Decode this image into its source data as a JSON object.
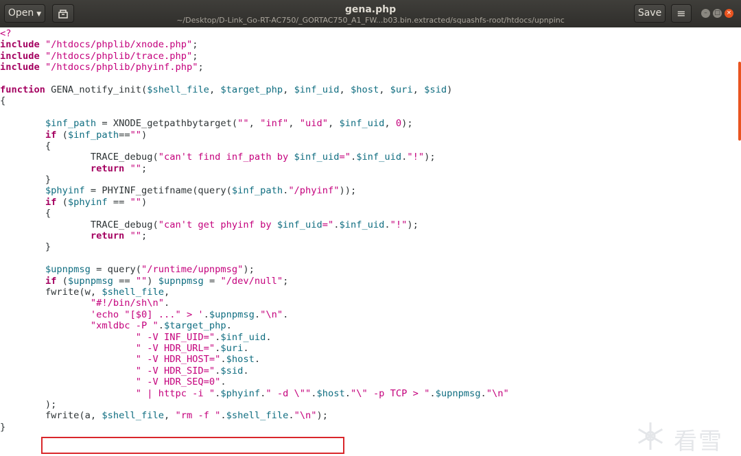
{
  "titlebar": {
    "open_label": "Open",
    "recent_icon": "document-recent-icon",
    "title": "gena.php",
    "path": "~/Desktop/D-Link_Go-RT-AC750/_GORTAC750_A1_FW...b03.bin.extracted/squashfs-root/htdocs/upnpinc",
    "save_label": "Save",
    "menu_icon": "hamburger-menu-icon",
    "window_controls": [
      "minimize-icon",
      "maximize-icon",
      "close-icon"
    ]
  },
  "colors": {
    "titlebar": "#3a3936",
    "keyword": "#a40060",
    "string": "#c4007c",
    "variable": "#0f6d80",
    "accent": "#e95420",
    "highlight_box": "#d9262a"
  },
  "code_lines": [
    [
      {
        "t": "<?",
        "c": "str"
      }
    ],
    [
      {
        "t": "include",
        "c": "kw"
      },
      {
        "t": " "
      },
      {
        "t": "\"/htdocs/phplib/xnode.php\"",
        "c": "str"
      },
      {
        "t": ";"
      }
    ],
    [
      {
        "t": "include",
        "c": "kw"
      },
      {
        "t": " "
      },
      {
        "t": "\"/htdocs/phplib/trace.php\"",
        "c": "str"
      },
      {
        "t": ";"
      }
    ],
    [
      {
        "t": "include",
        "c": "kw"
      },
      {
        "t": " "
      },
      {
        "t": "\"/htdocs/phplib/phyinf.php\"",
        "c": "str"
      },
      {
        "t": ";"
      }
    ],
    [],
    [
      {
        "t": "function",
        "c": "kw"
      },
      {
        "t": " GENA_notify_init("
      },
      {
        "t": "$shell_file",
        "c": "var"
      },
      {
        "t": ", "
      },
      {
        "t": "$target_php",
        "c": "var"
      },
      {
        "t": ", "
      },
      {
        "t": "$inf_uid",
        "c": "var"
      },
      {
        "t": ", "
      },
      {
        "t": "$host",
        "c": "var"
      },
      {
        "t": ", "
      },
      {
        "t": "$uri",
        "c": "var"
      },
      {
        "t": ", "
      },
      {
        "t": "$sid",
        "c": "var"
      },
      {
        "t": ")"
      }
    ],
    [
      {
        "t": "{"
      }
    ],
    [],
    [
      {
        "t": "        "
      },
      {
        "t": "$inf_path",
        "c": "var"
      },
      {
        "t": " = XNODE_getpathbytarget("
      },
      {
        "t": "\"\"",
        "c": "str"
      },
      {
        "t": ", "
      },
      {
        "t": "\"inf\"",
        "c": "str"
      },
      {
        "t": ", "
      },
      {
        "t": "\"uid\"",
        "c": "str"
      },
      {
        "t": ", "
      },
      {
        "t": "$inf_uid",
        "c": "var"
      },
      {
        "t": ", "
      },
      {
        "t": "0",
        "c": "str"
      },
      {
        "t": ");"
      }
    ],
    [
      {
        "t": "        "
      },
      {
        "t": "if",
        "c": "kw"
      },
      {
        "t": " ("
      },
      {
        "t": "$inf_path",
        "c": "var"
      },
      {
        "t": "=="
      },
      {
        "t": "\"\"",
        "c": "str"
      },
      {
        "t": ")"
      }
    ],
    [
      {
        "t": "        {"
      }
    ],
    [
      {
        "t": "                TRACE_debug("
      },
      {
        "t": "\"can't find inf_path by ",
        "c": "str"
      },
      {
        "t": "$inf_uid",
        "c": "var"
      },
      {
        "t": "=\"",
        "c": "str"
      },
      {
        "t": "."
      },
      {
        "t": "$inf_uid",
        "c": "var"
      },
      {
        "t": "."
      },
      {
        "t": "\"!\"",
        "c": "str"
      },
      {
        "t": ");"
      }
    ],
    [
      {
        "t": "                "
      },
      {
        "t": "return",
        "c": "kw"
      },
      {
        "t": " "
      },
      {
        "t": "\"\"",
        "c": "str"
      },
      {
        "t": ";"
      }
    ],
    [
      {
        "t": "        }"
      }
    ],
    [
      {
        "t": "        "
      },
      {
        "t": "$phyinf",
        "c": "var"
      },
      {
        "t": " = PHYINF_getifname(query("
      },
      {
        "t": "$inf_path",
        "c": "var"
      },
      {
        "t": "."
      },
      {
        "t": "\"/phyinf\"",
        "c": "str"
      },
      {
        "t": "));"
      }
    ],
    [
      {
        "t": "        "
      },
      {
        "t": "if",
        "c": "kw"
      },
      {
        "t": " ("
      },
      {
        "t": "$phyinf",
        "c": "var"
      },
      {
        "t": " == "
      },
      {
        "t": "\"\"",
        "c": "str"
      },
      {
        "t": ")"
      }
    ],
    [
      {
        "t": "        {"
      }
    ],
    [
      {
        "t": "                TRACE_debug("
      },
      {
        "t": "\"can't get phyinf by ",
        "c": "str"
      },
      {
        "t": "$inf_uid",
        "c": "var"
      },
      {
        "t": "=\"",
        "c": "str"
      },
      {
        "t": "."
      },
      {
        "t": "$inf_uid",
        "c": "var"
      },
      {
        "t": "."
      },
      {
        "t": "\"!\"",
        "c": "str"
      },
      {
        "t": ");"
      }
    ],
    [
      {
        "t": "                "
      },
      {
        "t": "return",
        "c": "kw"
      },
      {
        "t": " "
      },
      {
        "t": "\"\"",
        "c": "str"
      },
      {
        "t": ";"
      }
    ],
    [
      {
        "t": "        }"
      }
    ],
    [],
    [
      {
        "t": "        "
      },
      {
        "t": "$upnpmsg",
        "c": "var"
      },
      {
        "t": " = query("
      },
      {
        "t": "\"/runtime/upnpmsg\"",
        "c": "str"
      },
      {
        "t": ");"
      }
    ],
    [
      {
        "t": "        "
      },
      {
        "t": "if",
        "c": "kw"
      },
      {
        "t": " ("
      },
      {
        "t": "$upnpmsg",
        "c": "var"
      },
      {
        "t": " == "
      },
      {
        "t": "\"\"",
        "c": "str"
      },
      {
        "t": ") "
      },
      {
        "t": "$upnpmsg",
        "c": "var"
      },
      {
        "t": " = "
      },
      {
        "t": "\"/dev/null\"",
        "c": "str"
      },
      {
        "t": ";"
      }
    ],
    [
      {
        "t": "        fwrite(w, "
      },
      {
        "t": "$shell_file",
        "c": "var"
      },
      {
        "t": ","
      }
    ],
    [
      {
        "t": "                "
      },
      {
        "t": "\"#!/bin/sh\\n\"",
        "c": "str"
      },
      {
        "t": "."
      }
    ],
    [
      {
        "t": "                "
      },
      {
        "t": "'echo \"[$0] ...\" > '",
        "c": "str"
      },
      {
        "t": "."
      },
      {
        "t": "$upnpmsg",
        "c": "var"
      },
      {
        "t": "."
      },
      {
        "t": "\"\\n\"",
        "c": "str"
      },
      {
        "t": "."
      }
    ],
    [
      {
        "t": "                "
      },
      {
        "t": "\"xmldbc -P \"",
        "c": "str"
      },
      {
        "t": "."
      },
      {
        "t": "$target_php",
        "c": "var"
      },
      {
        "t": "."
      }
    ],
    [
      {
        "t": "                        "
      },
      {
        "t": "\" -V INF_UID=\"",
        "c": "str"
      },
      {
        "t": "."
      },
      {
        "t": "$inf_uid",
        "c": "var"
      },
      {
        "t": "."
      }
    ],
    [
      {
        "t": "                        "
      },
      {
        "t": "\" -V HDR_URL=\"",
        "c": "str"
      },
      {
        "t": "."
      },
      {
        "t": "$uri",
        "c": "var"
      },
      {
        "t": "."
      }
    ],
    [
      {
        "t": "                        "
      },
      {
        "t": "\" -V HDR_HOST=\"",
        "c": "str"
      },
      {
        "t": "."
      },
      {
        "t": "$host",
        "c": "var"
      },
      {
        "t": "."
      }
    ],
    [
      {
        "t": "                        "
      },
      {
        "t": "\" -V HDR_SID=\"",
        "c": "str"
      },
      {
        "t": "."
      },
      {
        "t": "$sid",
        "c": "var"
      },
      {
        "t": "."
      }
    ],
    [
      {
        "t": "                        "
      },
      {
        "t": "\" -V HDR_SEQ=0\"",
        "c": "str"
      },
      {
        "t": "."
      }
    ],
    [
      {
        "t": "                        "
      },
      {
        "t": "\" | httpc -i \"",
        "c": "str"
      },
      {
        "t": "."
      },
      {
        "t": "$phyinf",
        "c": "var"
      },
      {
        "t": "."
      },
      {
        "t": "\" -d \\\"\"",
        "c": "str"
      },
      {
        "t": "."
      },
      {
        "t": "$host",
        "c": "var"
      },
      {
        "t": "."
      },
      {
        "t": "\"\\\" -p TCP > \"",
        "c": "str"
      },
      {
        "t": "."
      },
      {
        "t": "$upnpmsg",
        "c": "var"
      },
      {
        "t": "."
      },
      {
        "t": "\"\\n\"",
        "c": "str"
      }
    ],
    [
      {
        "t": "        );"
      }
    ],
    [
      {
        "t": "        fwrite(a, "
      },
      {
        "t": "$shell_file",
        "c": "var"
      },
      {
        "t": ", "
      },
      {
        "t": "\"rm -f \"",
        "c": "str"
      },
      {
        "t": "."
      },
      {
        "t": "$shell_file",
        "c": "var"
      },
      {
        "t": "."
      },
      {
        "t": "\"\\n\"",
        "c": "str"
      },
      {
        "t": ");"
      }
    ],
    [
      {
        "t": "}"
      }
    ]
  ],
  "watermark": {
    "icon": "snowflake-icon",
    "text": "看雪"
  }
}
